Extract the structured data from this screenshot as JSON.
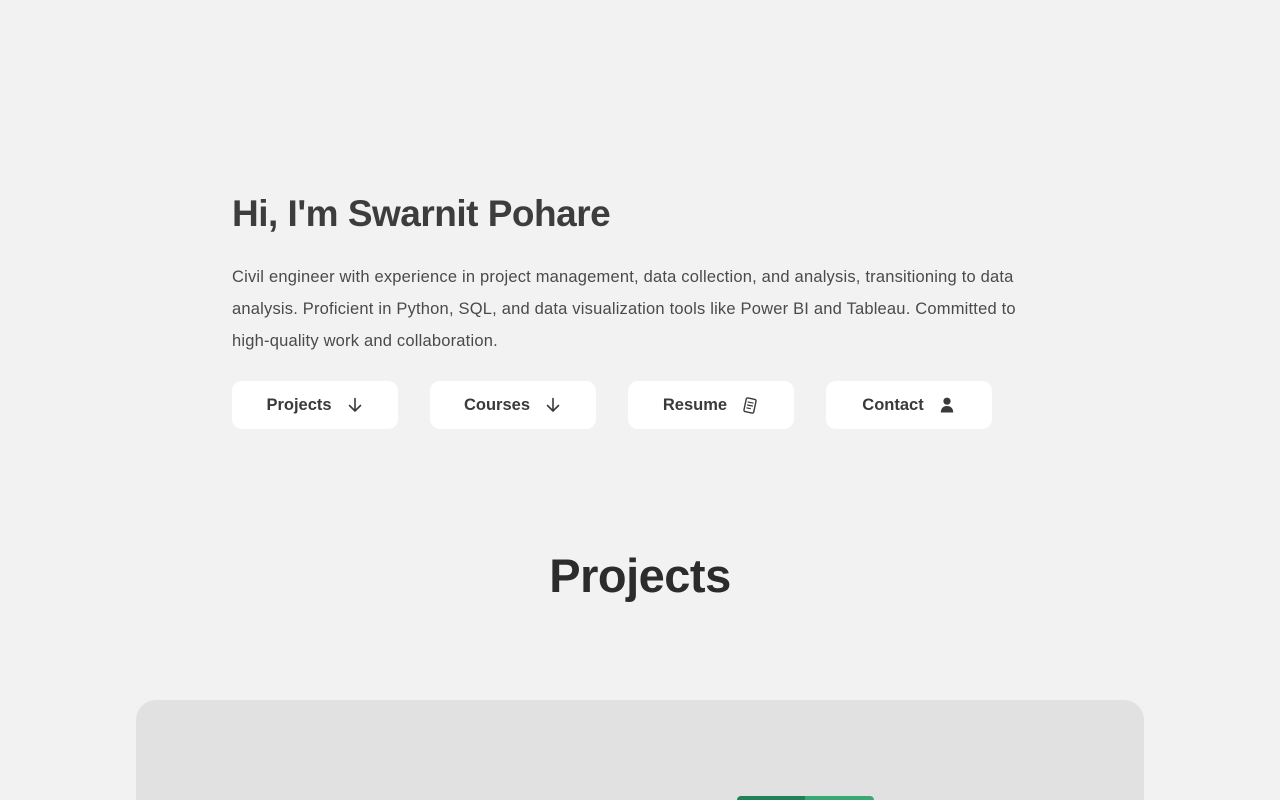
{
  "hero": {
    "title": "Hi, I'm Swarnit Pohare",
    "bio": "Civil engineer with experience in project management, data collection, and analysis, transitioning to data analysis. Proficient in Python, SQL, and data visualization tools like Power BI and Tableau. Committed to high-quality work and collaboration.",
    "buttons": [
      {
        "label": "Projects",
        "icon": "arrow-down-icon"
      },
      {
        "label": "Courses",
        "icon": "arrow-down-icon"
      },
      {
        "label": "Resume",
        "icon": "document-icon"
      },
      {
        "label": "Contact",
        "icon": "user-icon"
      }
    ]
  },
  "projects": {
    "heading": "Projects"
  },
  "colors": {
    "background": "#f2f2f2",
    "button_bg": "#ffffff",
    "card_bg": "#e1e1e1",
    "text_dark": "#3d3d3d",
    "accent_green": "#21825a"
  }
}
